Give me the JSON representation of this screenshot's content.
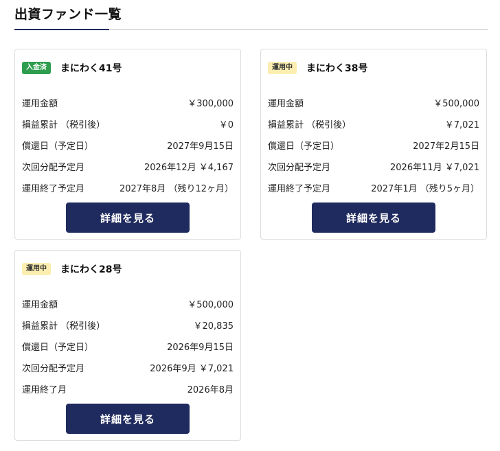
{
  "page": {
    "title": "出資ファンド一覧"
  },
  "colors": {
    "primary": "#1f2a5e",
    "badge_done": "#2e9d4e",
    "badge_active": "#fbeeb0"
  },
  "funds": [
    {
      "status": "入金済",
      "name": "まにわく41号",
      "rows": [
        {
          "label": "運用金額",
          "value": "￥300,000"
        },
        {
          "label": "損益累計 （税引後）",
          "value": "￥0"
        },
        {
          "label": "償還日（予定日）",
          "value": "2027年9月15日"
        },
        {
          "label": "次回分配予定月",
          "value": "2026年12月 ￥4,167"
        },
        {
          "label": "運用終了予定月",
          "value": "2027年8月 （残り12ヶ月）"
        }
      ],
      "button_label": "詳細を見る"
    },
    {
      "status": "運用中",
      "name": "まにわく38号",
      "rows": [
        {
          "label": "運用金額",
          "value": "￥500,000"
        },
        {
          "label": "損益累計 （税引後）",
          "value": "￥7,021"
        },
        {
          "label": "償還日（予定日）",
          "value": "2027年2月15日"
        },
        {
          "label": "次回分配予定月",
          "value": "2026年11月 ￥7,021"
        },
        {
          "label": "運用終了予定月",
          "value": "2027年1月 （残り5ヶ月）"
        }
      ],
      "button_label": "詳細を見る"
    },
    {
      "status": "運用中",
      "name": "まにわく28号",
      "rows": [
        {
          "label": "運用金額",
          "value": "￥500,000"
        },
        {
          "label": "損益累計 （税引後）",
          "value": "￥20,835"
        },
        {
          "label": "償還日（予定日）",
          "value": "2026年9月15日"
        },
        {
          "label": "次回分配予定月",
          "value": "2026年9月 ￥7,021"
        },
        {
          "label": "運用終了月",
          "value": "2026年8月"
        }
      ],
      "button_label": "詳細を見る"
    }
  ]
}
